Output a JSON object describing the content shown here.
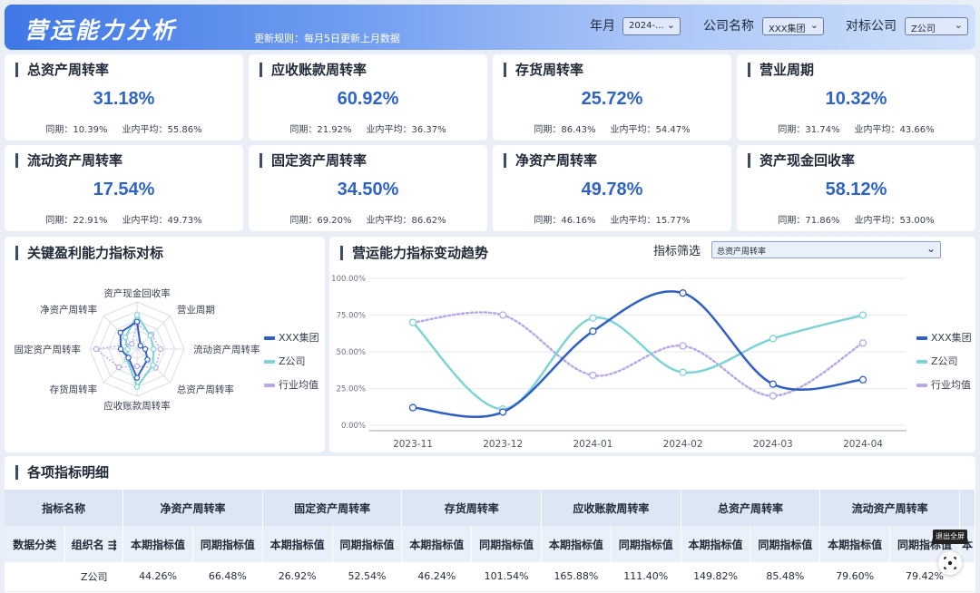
{
  "header": {
    "title": "营运能力分析",
    "rule": "更新规则：每月5日更新上月数据",
    "filters": [
      {
        "label": "年月",
        "value": "2024-..."
      },
      {
        "label": "公司名称",
        "value": "XXX集团"
      },
      {
        "label": "对标公司",
        "value": "Z公司"
      }
    ]
  },
  "kpis": [
    {
      "title": "总资产周转率",
      "value": "31.18%",
      "yoy_label": "同期：",
      "yoy": "10.39%",
      "avg_label": "业内平均：",
      "avg": "55.86%"
    },
    {
      "title": "应收账款周转率",
      "value": "60.92%",
      "yoy_label": "同期：",
      "yoy": "21.92%",
      "avg_label": "业内平均：",
      "avg": "36.37%"
    },
    {
      "title": "存货周转率",
      "value": "25.72%",
      "yoy_label": "同期：",
      "yoy": "86.43%",
      "avg_label": "业内平均：",
      "avg": "54.47%"
    },
    {
      "title": "营业周期",
      "value": "10.32%",
      "yoy_label": "同期：",
      "yoy": "31.74%",
      "avg_label": "业内平均：",
      "avg": "43.66%"
    },
    {
      "title": "流动资产周转率",
      "value": "17.54%",
      "yoy_label": "同期：",
      "yoy": "22.91%",
      "avg_label": "业内平均：",
      "avg": "49.73%"
    },
    {
      "title": "固定资产周转率",
      "value": "34.50%",
      "yoy_label": "同期：",
      "yoy": "69.20%",
      "avg_label": "业内平均：",
      "avg": "86.62%"
    },
    {
      "title": "净资产周转率",
      "value": "49.78%",
      "yoy_label": "同期：",
      "yoy": "46.16%",
      "avg_label": "业内平均：",
      "avg": "15.77%"
    },
    {
      "title": "资产现金回收率",
      "value": "58.12%",
      "yoy_label": "同期：",
      "yoy": "71.86%",
      "avg_label": "业内平均：",
      "avg": "53.00%"
    }
  ],
  "radar_panel": {
    "title": "关键盈利能力指标对标"
  },
  "trend_panel": {
    "title": "营运能力指标变动趋势",
    "filter_label": "指标筛选",
    "filter_value": "总资产周转率"
  },
  "legend": [
    {
      "name": "XXX集团",
      "color": "#2f5fc4"
    },
    {
      "name": "Z公司",
      "color": "#7fd3d4"
    },
    {
      "name": "行业均值",
      "color": "#b9a8e6"
    }
  ],
  "chart_data": [
    {
      "type": "radar",
      "title": "关键盈利能力指标对标",
      "axes": [
        "资产现金回收率",
        "营业周期",
        "流动资产周转率",
        "总资产周转率",
        "应收账款周转率",
        "存货周转率",
        "固定资产周转率",
        "净资产周转率"
      ],
      "max": 100,
      "series": [
        {
          "name": "XXX集团",
          "values": [
            58.12,
            10.32,
            17.54,
            31.18,
            60.92,
            25.72,
            34.5,
            49.78
          ]
        },
        {
          "name": "Z公司",
          "values": [
            72,
            40,
            35,
            48,
            80,
            30,
            20,
            35
          ]
        },
        {
          "name": "行业均值",
          "values": [
            53.0,
            43.66,
            49.73,
            55.86,
            36.37,
            54.47,
            86.62,
            15.77
          ]
        }
      ]
    },
    {
      "type": "line",
      "title": "营运能力指标变动趋势",
      "categories": [
        "2023-11",
        "2023-12",
        "2024-01",
        "2024-02",
        "2024-03",
        "2024-04"
      ],
      "ylim": [
        0,
        100
      ],
      "yticks": [
        "0.00%",
        "25.00%",
        "50.00%",
        "75.00%",
        "100.00%"
      ],
      "series": [
        {
          "name": "XXX集团",
          "values": [
            12,
            9,
            64,
            90,
            28,
            31
          ]
        },
        {
          "name": "Z公司",
          "values": [
            70,
            11,
            73,
            36,
            59,
            75
          ]
        },
        {
          "name": "行业均值",
          "values": [
            70,
            75,
            34,
            54,
            20,
            56
          ]
        }
      ]
    }
  ],
  "table": {
    "title": "各项指标明细",
    "group_header": "指标名称",
    "metrics": [
      "净资产周转率",
      "固定资产周转率",
      "存货周转率",
      "应收账款周转率",
      "总资产周转率",
      "流动资产周转率"
    ],
    "sub_headers": {
      "category": "数据分类",
      "org": "组织名 ⇶",
      "current": "本期指标值",
      "prior": "同期指标值",
      "overflow": "本"
    },
    "rows": [
      {
        "category": "",
        "org": "Z公司",
        "values": [
          "44.26%",
          "66.48%",
          "26.92%",
          "52.54%",
          "46.24%",
          "101.54%",
          "165.88%",
          "111.40%",
          "149.82%",
          "85.48%",
          "79.60%",
          "79.42%"
        ]
      }
    ]
  },
  "exit_fullscreen_tip": "退出全屏"
}
